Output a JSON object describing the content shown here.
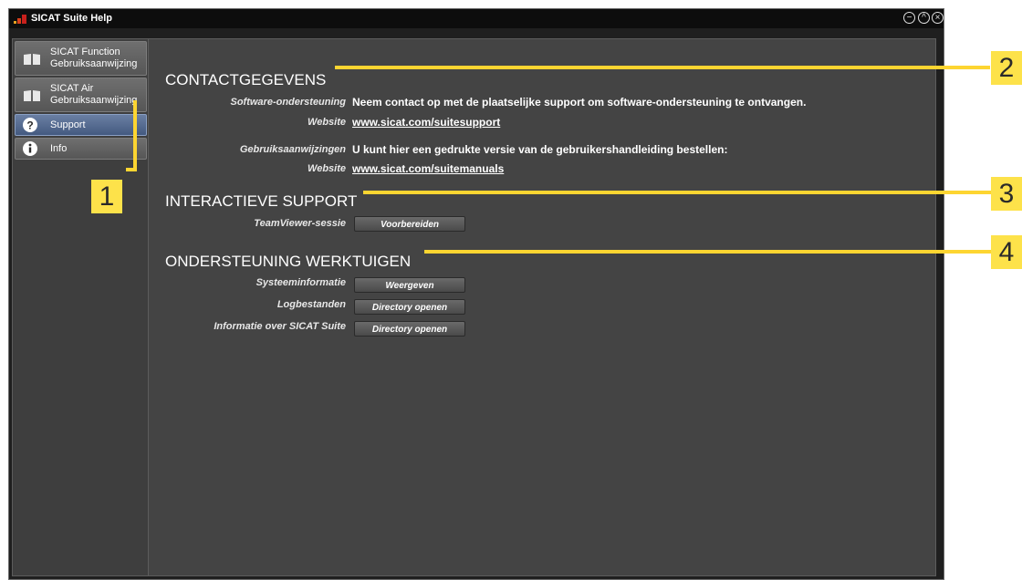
{
  "window": {
    "title": "SICAT Suite Help"
  },
  "sidebar": {
    "items": [
      {
        "line1": "SICAT Function",
        "line2": "Gebruiksaanwijzing",
        "icon": "book-icon"
      },
      {
        "line1": "SICAT Air",
        "line2": "Gebruiksaanwijzing",
        "icon": "book-icon"
      },
      {
        "line1": "Support",
        "line2": "",
        "icon": "question-icon"
      },
      {
        "line1": "Info",
        "line2": "",
        "icon": "info-icon"
      }
    ]
  },
  "contact": {
    "heading": "CONTACTGEGEVENS",
    "software_label": "Software-ondersteuning",
    "software_text": "Neem contact op met de plaatselijke support om software-ondersteuning te ontvangen.",
    "website_label_1": "Website",
    "website_link_1": "www.sicat.com/suitesupport",
    "manuals_label": "Gebruiksaanwijzingen",
    "manuals_text": "U kunt hier een gedrukte versie van de gebruikershandleiding bestellen:",
    "website_label_2": "Website",
    "website_link_2": "www.sicat.com/suitemanuals"
  },
  "interactive": {
    "heading": "INTERACTIEVE SUPPORT",
    "teamviewer_label": "TeamViewer-sessie",
    "teamviewer_button": "Voorbereiden"
  },
  "tools": {
    "heading": "ONDERSTEUNING WERKTUIGEN",
    "sysinfo_label": "Systeeminformatie",
    "sysinfo_button": "Weergeven",
    "logs_label": "Logbestanden",
    "logs_button": "Directory openen",
    "suiteinfo_label": "Informatie over SICAT Suite",
    "suiteinfo_button": "Directory openen"
  },
  "callouts": [
    "1",
    "2",
    "3",
    "4"
  ],
  "colors": {
    "callout": "#fdd531",
    "active_nav": "#4d6288"
  }
}
